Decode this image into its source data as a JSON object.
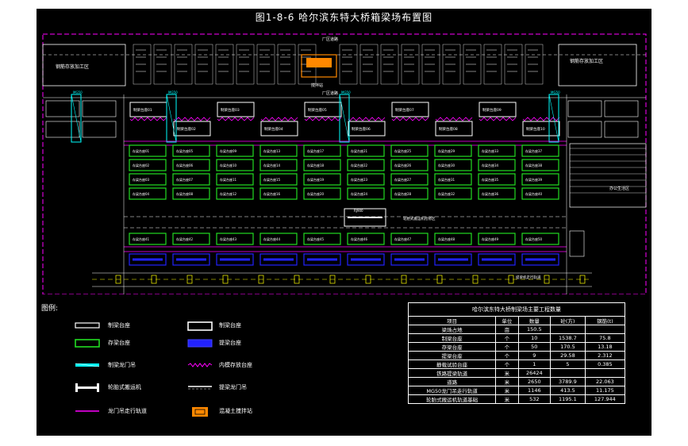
{
  "title": "图1-8-6 哈尔滨东特大桥箱梁场布置图",
  "plan": {
    "road_label_top": "厂区道路",
    "road_label_mid": "厂区道路",
    "rebar_area_left": "钢筋存放加工区",
    "rebar_area_right": "钢筋存放加工区",
    "mixing_station_label": "搅拌站",
    "crane_labels": [
      "MG50",
      "MG50",
      "MG50",
      "MG50"
    ],
    "production_pedestals": [
      "制梁台座01",
      "制梁台座03",
      "制梁台座05",
      "制梁台座07",
      "制梁台座09"
    ],
    "production_pedestals_b": [
      "制梁台座02",
      "制梁台座04",
      "制梁台座06",
      "制梁台座08",
      "制梁台座10"
    ],
    "office_label": "办公生活区",
    "beam_mover_label": "轮胎式搬运机检修区",
    "track_label": "提梁机走行轨道",
    "distance_label": "RJ900",
    "storage_prefix": "存梁台座"
  },
  "legend": {
    "heading": "图例:",
    "items": [
      {
        "label": "制梁台座",
        "icon": "white-rect-icon"
      },
      {
        "label": "存梁台座",
        "icon": "green-rect-icon"
      },
      {
        "label": "制梁龙门吊",
        "icon": "cyan-gantry-icon"
      },
      {
        "label": "轮胎式搬运机",
        "icon": "white-hbeam-icon"
      },
      {
        "label": "龙门吊走行轨道",
        "icon": "magenta-line-icon"
      },
      {
        "label": "制梁台座",
        "icon": "white-box-icon"
      },
      {
        "label": "提梁台座",
        "icon": "blue-rect-icon"
      },
      {
        "label": "内模存放台座",
        "icon": "magenta-zigzag-icon"
      },
      {
        "label": "提梁龙门吊",
        "icon": "white-dashbeam-icon"
      },
      {
        "label": "混凝土搅拌站",
        "icon": "orange-mixer-icon"
      }
    ]
  },
  "table": {
    "caption": "哈尔滨东特大桥制梁场主要工程数量",
    "headers": [
      "项目",
      "单位",
      "数量",
      "砼(方)",
      "钢筋(t)"
    ],
    "rows": [
      [
        "梁场占地",
        "亩",
        "150.5",
        "",
        ""
      ],
      [
        "制梁台座",
        "个",
        "10",
        "1538.7",
        "75.8"
      ],
      [
        "存梁台座",
        "个",
        "50",
        "170.5",
        "13.18"
      ],
      [
        "提梁台座",
        "个",
        "9",
        "29.58",
        "2.312"
      ],
      [
        "静载试验台座",
        "个",
        "1",
        "5",
        "0.385"
      ],
      [
        "铁路提梁轨道",
        "米",
        "26424",
        "",
        ""
      ],
      [
        "道路",
        "米",
        "2650",
        "3789.9",
        "22.063"
      ],
      [
        "MG50龙门吊走行轨道",
        "米",
        "1146",
        "413.5",
        "11.175"
      ],
      [
        "轮胎式搬运机轨道基础",
        "米",
        "532",
        "1195.1",
        "127.944"
      ]
    ]
  },
  "colors": {
    "background": "#000000",
    "storage": "#22dd22",
    "lifting": "#2222ff",
    "gantry": "#00ffff",
    "rail": "#ff00ff",
    "mixer": "#ff8800",
    "outline": "#ffffff"
  }
}
